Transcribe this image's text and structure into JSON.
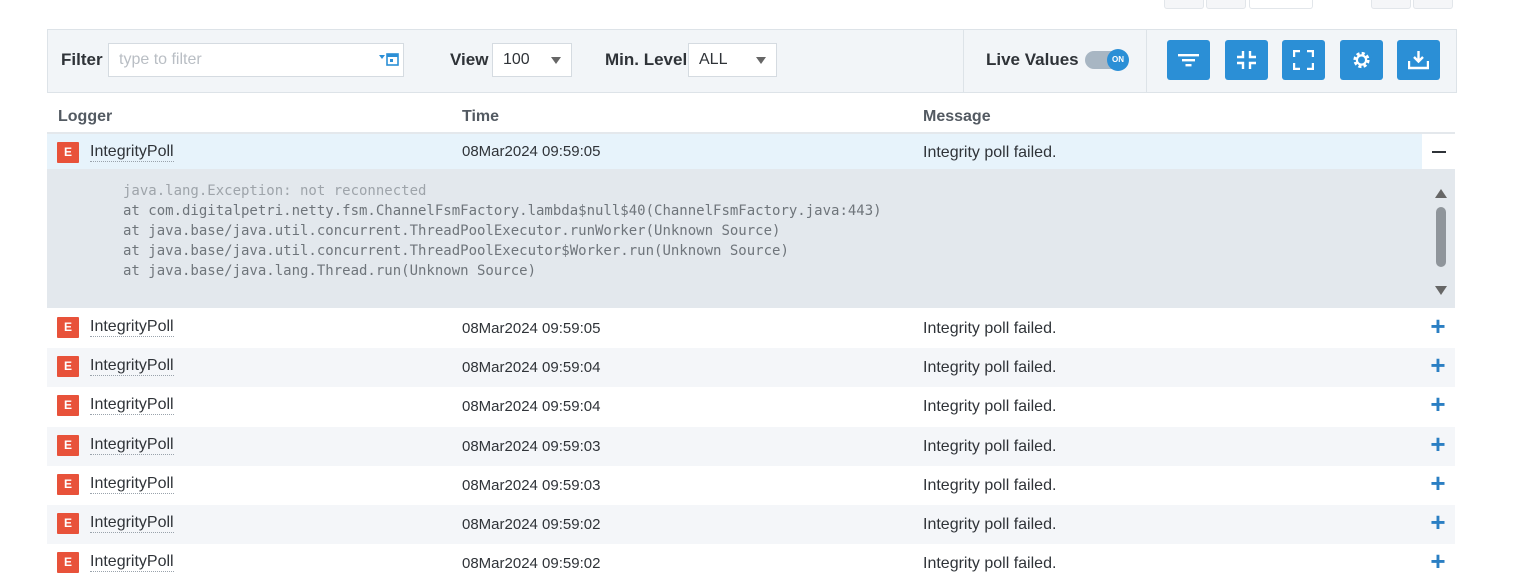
{
  "toolbar": {
    "filter_label": "Filter",
    "filter_placeholder": "type to filter",
    "view_label": "View",
    "view_value": "100",
    "min_level_label": "Min. Level",
    "min_level_value": "ALL",
    "live_values_label": "Live Values",
    "live_toggle_text": "ON",
    "buttons": [
      "filter-lines-icon",
      "collapse-icon",
      "expand-icon",
      "gear-icon",
      "download-icon"
    ]
  },
  "table": {
    "columns": [
      "Logger",
      "Time",
      "Message"
    ],
    "expanded_row": {
      "level": "E",
      "logger": "IntegrityPoll",
      "time": "08Mar2024 09:59:05",
      "message": "Integrity poll failed.",
      "trace_first": "java.lang.Exception: not reconnected",
      "trace_rest": "at com.digitalpetri.netty.fsm.ChannelFsmFactory.lambda$null$40(ChannelFsmFactory.java:443)\nat java.base/java.util.concurrent.ThreadPoolExecutor.runWorker(Unknown Source)\nat java.base/java.util.concurrent.ThreadPoolExecutor$Worker.run(Unknown Source)\nat java.base/java.lang.Thread.run(Unknown Source)"
    },
    "rows": [
      {
        "level": "E",
        "logger": "IntegrityPoll",
        "time": "08Mar2024 09:59:05",
        "message": "Integrity poll failed."
      },
      {
        "level": "E",
        "logger": "IntegrityPoll",
        "time": "08Mar2024 09:59:04",
        "message": "Integrity poll failed."
      },
      {
        "level": "E",
        "logger": "IntegrityPoll",
        "time": "08Mar2024 09:59:04",
        "message": "Integrity poll failed."
      },
      {
        "level": "E",
        "logger": "IntegrityPoll",
        "time": "08Mar2024 09:59:03",
        "message": "Integrity poll failed."
      },
      {
        "level": "E",
        "logger": "IntegrityPoll",
        "time": "08Mar2024 09:59:03",
        "message": "Integrity poll failed."
      },
      {
        "level": "E",
        "logger": "IntegrityPoll",
        "time": "08Mar2024 09:59:02",
        "message": "Integrity poll failed."
      },
      {
        "level": "E",
        "logger": "IntegrityPoll",
        "time": "08Mar2024 09:59:02",
        "message": "Integrity poll failed."
      }
    ],
    "expand_symbol": "+"
  }
}
